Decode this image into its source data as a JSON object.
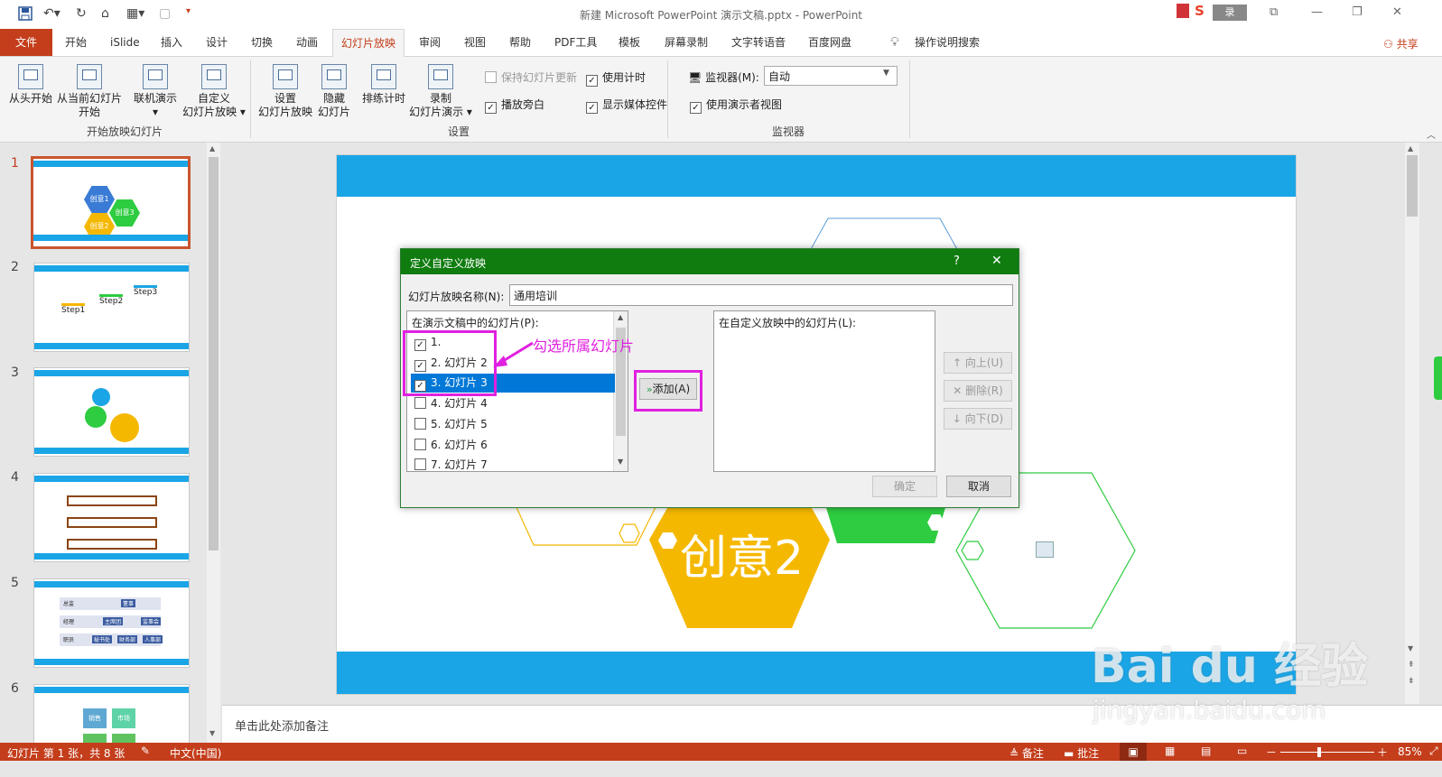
{
  "window": {
    "title": "新建 Microsoft PowerPoint 演示文稿.pptx  -  PowerPoint",
    "qat_icons": [
      "save-icon",
      "undo-icon",
      "redo-icon",
      "presenter-icon",
      "layout-icon",
      "new-icon",
      "customize-icon"
    ],
    "login_label": "录"
  },
  "tabs": {
    "file": "文件",
    "items": [
      "开始",
      "iSlide",
      "插入",
      "设计",
      "切换",
      "动画",
      "幻灯片放映",
      "审阅",
      "视图",
      "帮助",
      "PDF工具",
      "模板",
      "屏幕录制",
      "文字转语音",
      "百度网盘"
    ],
    "active": "幻灯片放映",
    "tell_me": "操作说明搜索",
    "share": "共享"
  },
  "ribbon": {
    "start_group": {
      "label": "开始放映幻灯片",
      "from_beginning": "从头开始",
      "from_current_1": "从当前幻灯片",
      "from_current_2": "开始",
      "online_1": "联机演示",
      "online_2": "▾",
      "custom_1": "自定义",
      "custom_2": "幻灯片放映 ▾"
    },
    "setup_group": {
      "label": "设置",
      "setup_1": "设置",
      "setup_2": "幻灯片放映",
      "hide_1": "隐藏",
      "hide_2": "幻灯片",
      "rehearse": "排练计时",
      "record_1": "录制",
      "record_2": "幻灯片演示 ▾",
      "keep_updated": "保持幻灯片更新",
      "use_timings": "使用计时",
      "play_narrations": "播放旁白",
      "show_media": "显示媒体控件"
    },
    "monitor_group": {
      "label": "监视器",
      "monitor_label": "监视器(M):",
      "monitor_value": "自动",
      "presenter_view": "使用演示者视图"
    }
  },
  "thumbnails": {
    "numbers": [
      "1",
      "2",
      "3",
      "4",
      "5",
      "6"
    ],
    "t1_labels": [
      "创意1",
      "创意3",
      "创意2"
    ],
    "t2_labels": [
      "Step1",
      "Step2",
      "Step3"
    ],
    "t5_labels": [
      "总监",
      "经理",
      "职员",
      "董事",
      "主席团",
      "监事会",
      "秘书处",
      "财务部",
      "人事部"
    ],
    "t6_labels": [
      "销售",
      "市场"
    ]
  },
  "slide": {
    "big_label": "创意2"
  },
  "notes": {
    "placeholder": "单击此处添加备注"
  },
  "dialog": {
    "title": "定义自定义放映",
    "help": "?",
    "close": "✕",
    "name_label": "幻灯片放映名称(N):",
    "name_value": "通用培训",
    "left_list_label": "在演示文稿中的幻灯片(P):",
    "right_list_label": "在自定义放映中的幻灯片(L):",
    "slides": [
      {
        "label": "1.",
        "checked": true
      },
      {
        "label": "2. 幻灯片 2",
        "checked": true
      },
      {
        "label": "3. 幻灯片 3",
        "checked": true
      },
      {
        "label": "4. 幻灯片 4",
        "checked": false
      },
      {
        "label": "5. 幻灯片 5",
        "checked": false
      },
      {
        "label": "6. 幻灯片 6",
        "checked": false
      },
      {
        "label": "7. 幻灯片 7",
        "checked": false
      }
    ],
    "selected_index": 2,
    "add_button": "添加(A)",
    "up_button": "向上(U)",
    "delete_button": "删除(R)",
    "down_button": "向下(D)",
    "ok_button": "确定",
    "cancel_button": "取消",
    "annotation": "勾选所属幻灯片"
  },
  "status": {
    "slide_info": "幻灯片 第 1 张，共 8 张",
    "language": "中文(中国)",
    "notes": "备注",
    "comments": "批注",
    "zoom": "85%",
    "zoom_minus": "－",
    "zoom_plus": "＋"
  },
  "watermark": {
    "logo_text": "Bai du 经验",
    "url": "jingyan.baidu.com"
  },
  "colors": {
    "accent": "#c43e1c",
    "dialog_title": "#107c10",
    "slide_band": "#1aa5e6",
    "yellow": "#f5b800",
    "green": "#2ecc40",
    "highlight": "#e020e0",
    "selection": "#0078d7"
  }
}
